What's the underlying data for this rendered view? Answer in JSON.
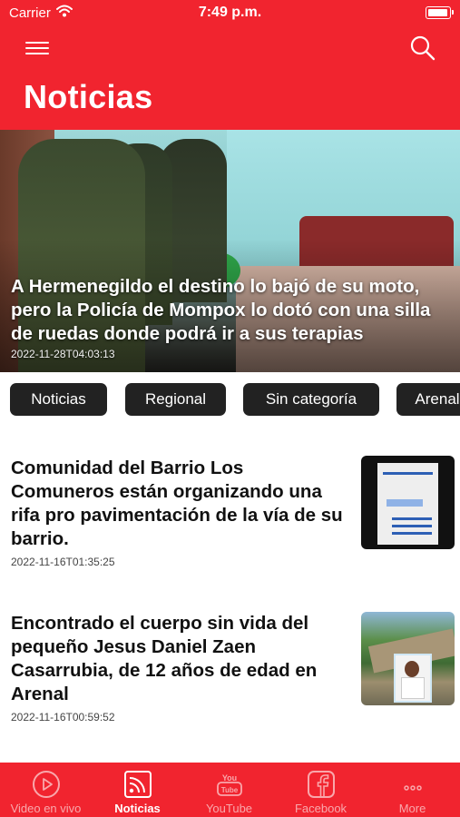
{
  "status_bar": {
    "carrier": "Carrier",
    "time": "7:49 p.m."
  },
  "header": {
    "title": "Noticias",
    "menu_icon": "hamburger-menu-icon",
    "search_icon": "search-icon"
  },
  "featured": {
    "headline": "A Hermenegildo el destino lo bajó de su moto, pero la Policía de Mompox lo dotó con una silla de ruedas donde podrá ir a sus terapias",
    "date": "2022-11-28T04:03:13"
  },
  "categories": [
    "Noticias",
    "Regional",
    "Sin categoría",
    "Arenal"
  ],
  "articles": [
    {
      "title": "Comunidad del Barrio Los Comuneros están organizando una rifa pro pavimentación de la vía de su barrio.",
      "date": "2022-11-16T01:35:25"
    },
    {
      "title": "Encontrado el cuerpo sin vida del pequeño Jesus Daniel Zaen Casarrubia, de 12 años de edad en Arenal",
      "date": "2022-11-16T00:59:52"
    }
  ],
  "tabbar": {
    "items": [
      {
        "label": "Video en vivo",
        "icon": "play-circle-icon"
      },
      {
        "label": "Noticias",
        "icon": "rss-feed-icon",
        "active": true
      },
      {
        "label": "YouTube",
        "icon": "youtube-icon"
      },
      {
        "label": "Facebook",
        "icon": "facebook-icon"
      },
      {
        "label": "More",
        "icon": "more-dots-icon"
      }
    ]
  },
  "colors": {
    "brand_red": "#f1242f",
    "chip_bg": "#222222",
    "text_dark": "#111111"
  }
}
